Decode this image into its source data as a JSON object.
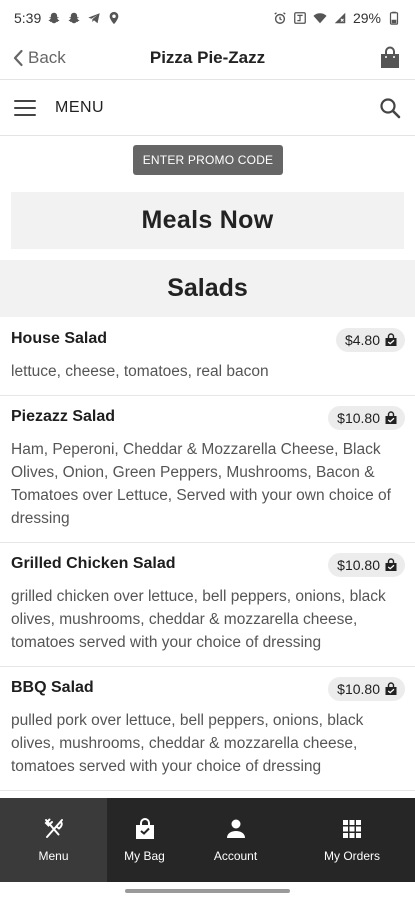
{
  "status_bar": {
    "time": "5:39",
    "battery": "29%",
    "left_icons": [
      "snapchat-icon",
      "snapchat-icon",
      "telegram-icon",
      "maps-pin-icon"
    ],
    "right_icons": [
      "alarm-icon",
      "nfc-icon",
      "wifi-icon",
      "signal-icon",
      "battery-icon"
    ]
  },
  "header": {
    "back_label": "Back",
    "title": "Pizza Pie-Zazz"
  },
  "menu_bar": {
    "label": "MENU"
  },
  "promo": {
    "label": "ENTER PROMO CODE"
  },
  "meals_now": {
    "label": "Meals Now"
  },
  "section": {
    "title": "Salads",
    "items": [
      {
        "name": "House Salad",
        "price": "$4.80",
        "description": "lettuce, cheese, tomatoes, real bacon"
      },
      {
        "name": "Piezazz Salad",
        "price": "$10.80",
        "description": "Ham, Peperoni, Cheddar & Mozzarella Cheese, Black Olives, Onion, Green Peppers, Mushrooms, Bacon & Tomatoes over Lettuce, Served with your own choice of dressing"
      },
      {
        "name": "Grilled Chicken Salad",
        "price": "$10.80",
        "description": "grilled chicken over lettuce, bell peppers, onions, black olives, mushrooms, cheddar & mozzarella cheese, tomatoes served with your choice of dressing"
      },
      {
        "name": "BBQ Salad",
        "price": "$10.80",
        "description": "pulled pork over lettuce, bell peppers, onions, black olives, mushrooms, cheddar & mozzarella cheese, tomatoes served with your choice of dressing"
      }
    ]
  },
  "bottom_nav": {
    "items": [
      {
        "label": "Menu",
        "icon": "fork-knife-icon",
        "active": true
      },
      {
        "label": "My Bag",
        "icon": "shopping-bag-icon",
        "active": false
      },
      {
        "label": "Account",
        "icon": "person-icon",
        "active": false
      },
      {
        "label": "My Orders",
        "icon": "grid-icon",
        "active": false
      }
    ]
  },
  "colors": {
    "promo_bg": "#666666",
    "panel_bg": "#f2f2f2",
    "nav_bg": "#262626",
    "nav_active_bg": "#3a3a3a"
  }
}
